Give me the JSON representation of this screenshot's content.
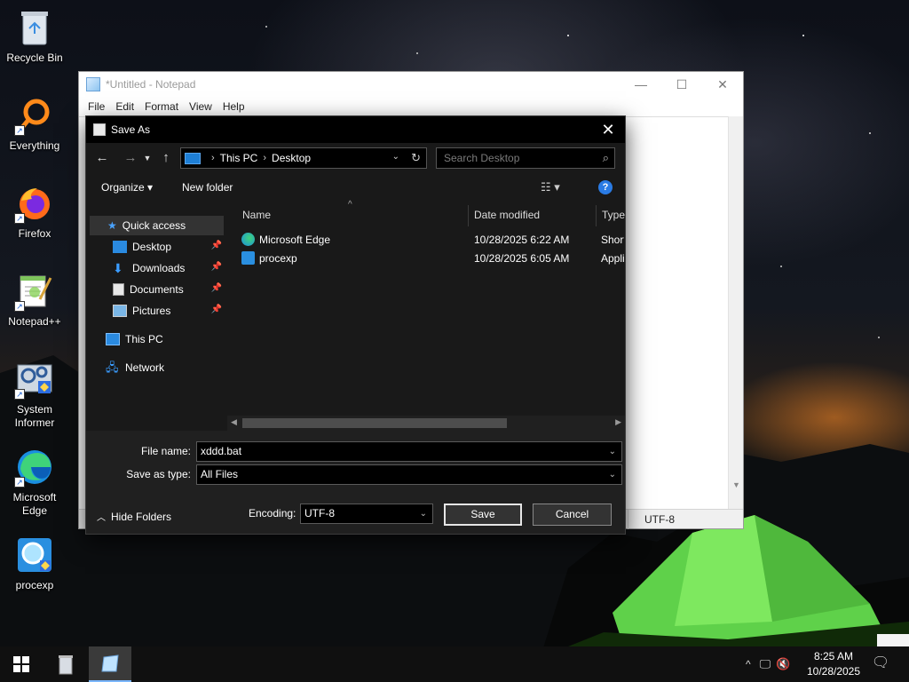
{
  "desktop": {
    "icons": [
      {
        "label": "Recycle Bin",
        "icon": "recycle-bin-icon"
      },
      {
        "label": "Everything",
        "icon": "everything-search-icon"
      },
      {
        "label": "Firefox",
        "icon": "firefox-icon"
      },
      {
        "label": "Notepad++",
        "icon": "notepadpp-icon"
      },
      {
        "label": "System\nInformer",
        "icon": "system-informer-icon"
      },
      {
        "label": "Microsoft\nEdge",
        "icon": "edge-icon"
      },
      {
        "label": "procexp",
        "icon": "procexp-icon"
      }
    ]
  },
  "notepad": {
    "title": "*Untitled - Notepad",
    "menu": [
      "File",
      "Edit",
      "Format",
      "View",
      "Help"
    ],
    "status_encoding": "UTF-8",
    "window_buttons": {
      "minimize": "—",
      "maximize": "☐",
      "close": "✕"
    }
  },
  "save_dialog": {
    "title": "Save As",
    "close_glyph": "✕",
    "breadcrumb": [
      "This PC",
      "Desktop"
    ],
    "search_placeholder": "Search Desktop",
    "toolbar": {
      "organize": "Organize ▾",
      "new_folder": "New folder",
      "help": "?"
    },
    "nav": {
      "quick_access": "Quick access",
      "items": [
        {
          "label": "Desktop",
          "icon": "desktop-folder-icon",
          "pinned": true
        },
        {
          "label": "Downloads",
          "icon": "downloads-arrow-icon",
          "pinned": true
        },
        {
          "label": "Documents",
          "icon": "documents-icon",
          "pinned": true
        },
        {
          "label": "Pictures",
          "icon": "pictures-icon",
          "pinned": true
        }
      ],
      "this_pc": "This PC",
      "network": "Network"
    },
    "columns": {
      "name": "Name",
      "date_modified": "Date modified",
      "type": "Type"
    },
    "files": [
      {
        "name": "Microsoft Edge",
        "date": "10/28/2025 6:22 AM",
        "type": "Short"
      },
      {
        "name": "procexp",
        "date": "10/28/2025 6:05 AM",
        "type": "Appli"
      }
    ],
    "file_name_label": "File name:",
    "file_name_value": "xddd.bat",
    "save_type_label": "Save as type:",
    "save_type_value": "All Files",
    "hide_folders": "Hide Folders",
    "encoding_label": "Encoding:",
    "encoding_value": "UTF-8",
    "save_button": "Save",
    "cancel_button": "Cancel"
  },
  "taskbar": {
    "time": "8:25 AM",
    "date": "10/28/2025",
    "tray_chevron": "^"
  },
  "colors": {
    "dialog_bg": "#191919",
    "dialog_title_bg": "#000000",
    "accent_blue": "#2a7be4",
    "taskbar_bg": "#101010"
  }
}
